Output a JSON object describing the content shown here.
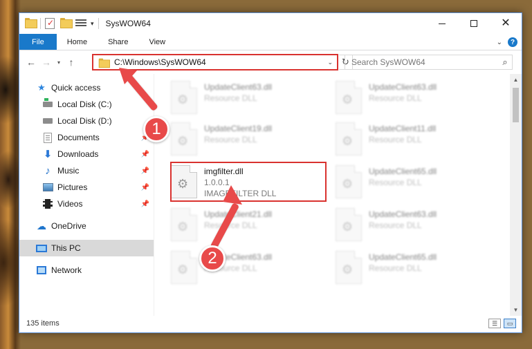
{
  "window": {
    "title": "SysWOW64",
    "qat_dropdown": "▾"
  },
  "ribbon": {
    "tabs": [
      "File",
      "Home",
      "Share",
      "View"
    ],
    "help": "?"
  },
  "nav": {
    "address": "C:\\Windows\\SysWOW64",
    "search_placeholder": "Search SysWOW64"
  },
  "sidebar": {
    "items": [
      {
        "label": "Quick access",
        "icon": "star-icon",
        "pinned": false
      },
      {
        "label": "Local Disk (C:)",
        "icon": "drive-c-icon",
        "pinned": false
      },
      {
        "label": "Local Disk (D:)",
        "icon": "drive-d-icon",
        "pinned": false
      },
      {
        "label": "Documents",
        "icon": "documents-icon",
        "pinned": true
      },
      {
        "label": "Downloads",
        "icon": "downloads-icon",
        "pinned": true
      },
      {
        "label": "Music",
        "icon": "music-icon",
        "pinned": true
      },
      {
        "label": "Pictures",
        "icon": "pictures-icon",
        "pinned": true
      },
      {
        "label": "Videos",
        "icon": "videos-icon",
        "pinned": true
      },
      {
        "label": "OneDrive",
        "icon": "onedrive-icon",
        "pinned": false
      },
      {
        "label": "This PC",
        "icon": "this-pc-icon",
        "pinned": false,
        "selected": true
      },
      {
        "label": "Network",
        "icon": "network-icon",
        "pinned": false
      }
    ]
  },
  "files": [
    {
      "name": "UpdateClient63.dll",
      "desc": "Resource DLL"
    },
    {
      "name": "UpdateClient63.dll",
      "desc": "Resource DLL"
    },
    {
      "name": "UpdateClient19.dll",
      "desc": "Resource DLL"
    },
    {
      "name": "UpdateClient11.dll",
      "desc": "Resource DLL"
    },
    {
      "name": "imgfilter.dll",
      "version": "1.0.0.1",
      "desc": "IMAGEFILTER DLL"
    },
    {
      "name": "UpdateClient65.dll",
      "desc": "Resource DLL"
    },
    {
      "name": "UpdateClient21.dll",
      "desc": "Resource DLL"
    },
    {
      "name": "UpdateClient63.dll",
      "desc": "Resource DLL"
    },
    {
      "name": "UpdateClient63.dll",
      "desc": "Resource DLL"
    },
    {
      "name": "UpdateClient65.dll",
      "desc": "Resource DLL"
    }
  ],
  "status": {
    "item_count": "135 items"
  },
  "callouts": [
    "1",
    "2"
  ],
  "colors": {
    "accent": "#1979ca",
    "highlight": "#d9322f",
    "callout": "#e84a4a"
  }
}
